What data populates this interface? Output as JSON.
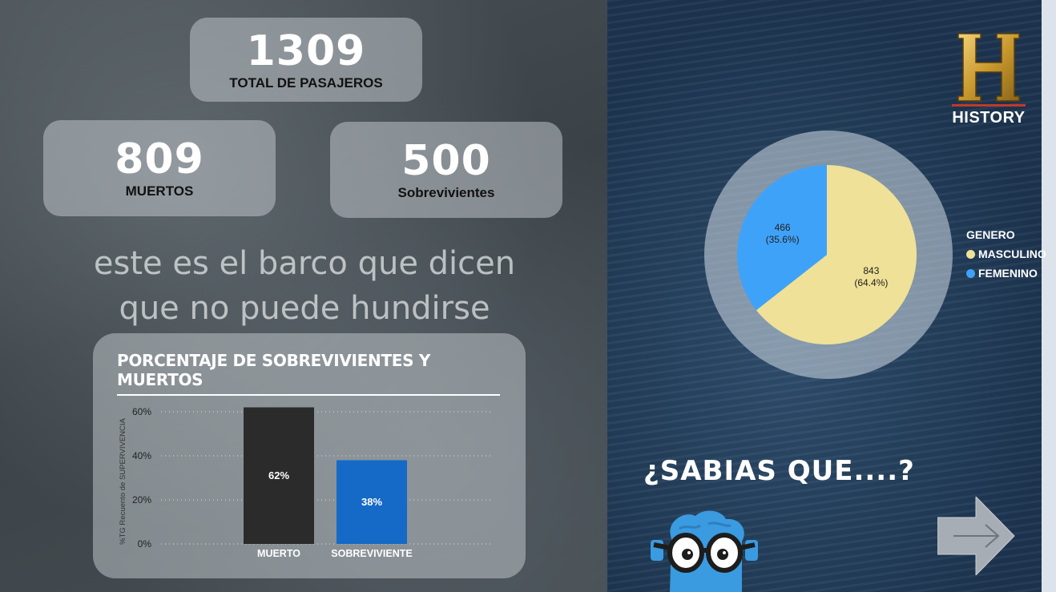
{
  "kpis": {
    "total": {
      "value": "1309",
      "label": "TOTAL DE PASAJEROS"
    },
    "muertos": {
      "value": "809",
      "label": "MUERTOS"
    },
    "sobrevivientes": {
      "value": "500",
      "label": "Sobrevivientes"
    }
  },
  "quote": {
    "line1": "este es el barco que dicen",
    "line2": "que no puede hundirse"
  },
  "chart_data": [
    {
      "type": "bar",
      "title": "PORCENTAJE DE SOBREVIVIENTES Y MUERTOS",
      "ylabel": "%TG Recuento de SUPERVIVENCIA",
      "xlabel": "",
      "categories": [
        "MUERTO",
        "SOBREVIVIENTE"
      ],
      "values": [
        62,
        38
      ],
      "data_labels": [
        "62%",
        "38%"
      ],
      "yticks": [
        "0%",
        "20%",
        "40%",
        "60%"
      ],
      "ylim": [
        0,
        65
      ],
      "grid": true,
      "colors": [
        "#2b2b2b",
        "#1569c7"
      ]
    },
    {
      "type": "pie",
      "legend_title": "GENERO",
      "legend_position": "right",
      "categories": [
        "MASCULINO",
        "FEMENINO"
      ],
      "values": [
        843,
        466
      ],
      "labels": [
        {
          "count": "843",
          "pct": "(64.4%)"
        },
        {
          "count": "466",
          "pct": "(35.6%)"
        }
      ],
      "colors": [
        "#efe197",
        "#3fa2f9"
      ]
    }
  ],
  "brand": {
    "logo_text": "HISTORY",
    "logo_letter": "H"
  },
  "callout": {
    "text": "¿SABIAS QUE....?"
  },
  "colors": {
    "accent_gold": "#c9992e",
    "bar_text": "#ffffff"
  },
  "icons": {
    "next": "arrow-right-icon",
    "mascot": "brain-glasses-icon"
  }
}
